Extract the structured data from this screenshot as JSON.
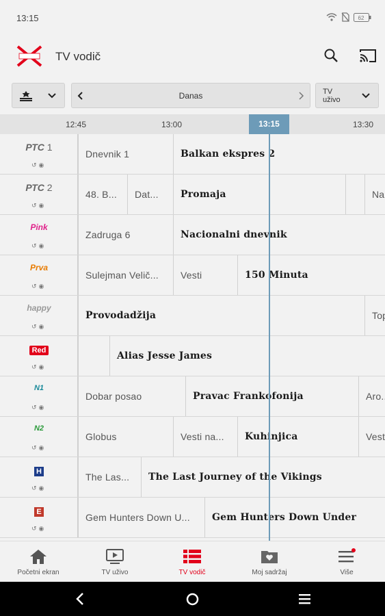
{
  "status": {
    "time": "13:15",
    "battery": "62"
  },
  "app": {
    "title": "TV vodič",
    "logo_text": "Xplore TV"
  },
  "filters": {
    "day": "Danas",
    "type": "TV uživo"
  },
  "timeline": {
    "ticks": [
      "12:45",
      "13:00",
      "13:15",
      "13:30"
    ],
    "now": "13:15"
  },
  "channels": [
    {
      "name": "РТС",
      "number": "1",
      "programs": [
        "Dnevnik 1",
        "Balkan ekspres 2"
      ]
    },
    {
      "name": "РТС",
      "number": "2",
      "programs": [
        "48. B...",
        "Dat...",
        "Promaja",
        "",
        "Na"
      ]
    },
    {
      "name": "Pink",
      "programs": [
        "Zadruga 6",
        "Nacionalni dnevnik"
      ]
    },
    {
      "name": "Prva",
      "programs": [
        "Sulejman Velič...",
        "Vesti",
        "150 Minuta"
      ]
    },
    {
      "name": "happy",
      "programs": [
        "Provodadžija",
        "Top"
      ]
    },
    {
      "name": "Red",
      "programs": [
        "",
        "Alias Jesse James"
      ]
    },
    {
      "name": "N1",
      "programs": [
        "Dobar posao",
        "Pravac Frankofonija",
        "Aro..."
      ]
    },
    {
      "name": "N2",
      "programs": [
        "Globus",
        "Vesti na...",
        "Kuhinjica",
        "Vest"
      ]
    },
    {
      "name": "H",
      "programs": [
        "The Las...",
        "The Last Journey of the Vikings"
      ]
    },
    {
      "name": "E",
      "programs": [
        "Gem Hunters Down U...",
        "Gem Hunters Down Under"
      ]
    }
  ],
  "nav": [
    {
      "label": "Početni ekran",
      "icon": "home-icon"
    },
    {
      "label": "TV uživo",
      "icon": "tv-icon"
    },
    {
      "label": "TV vodič",
      "icon": "guide-icon",
      "active": true
    },
    {
      "label": "Moj sadržaj",
      "icon": "folder-heart-icon"
    },
    {
      "label": "Više",
      "icon": "menu-icon"
    }
  ],
  "colors": {
    "accent": "#e2001a",
    "now_line": "#6d9bb8"
  }
}
